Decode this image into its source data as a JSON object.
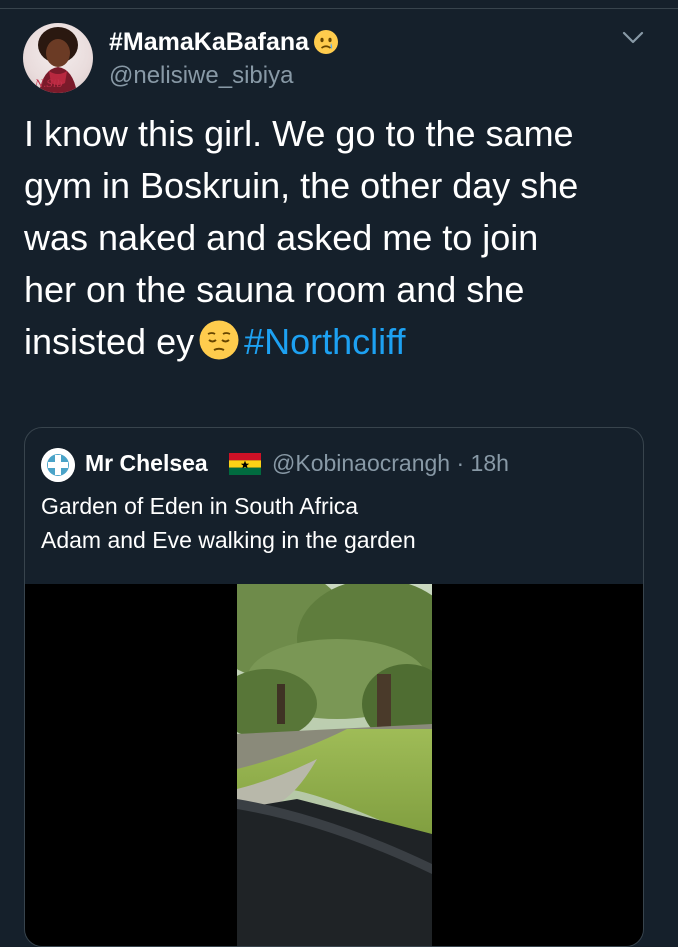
{
  "tweet": {
    "display_name": "#MamaKaBafana",
    "handle": "@nelisiwe_sibiya",
    "name_emoji_icon": "crying-face-emoji",
    "body_lines": [
      "I know this girl. We go to the same",
      "gym in Boskruin, the other day she",
      "was naked and asked me to join",
      "her on the sauna room and she",
      "insisted ey"
    ],
    "body_emoji_icon": "pensive-face-emoji",
    "hashtag": "#Northcliff",
    "hashtag_color": "#1da1f2"
  },
  "quoted_tweet": {
    "display_name": "Mr Chelsea",
    "flag_icon": "ghana-flag-emoji",
    "handle_time": "@Kobinaocrangh · 18h",
    "text_lines": [
      "Garden of Eden in South Africa",
      "Adam and Eve walking in the garden"
    ],
    "media_icon": "garden-video-thumbnail"
  },
  "colors": {
    "background": "#15202b",
    "secondary_text": "#8899a6",
    "border": "#38444d"
  }
}
